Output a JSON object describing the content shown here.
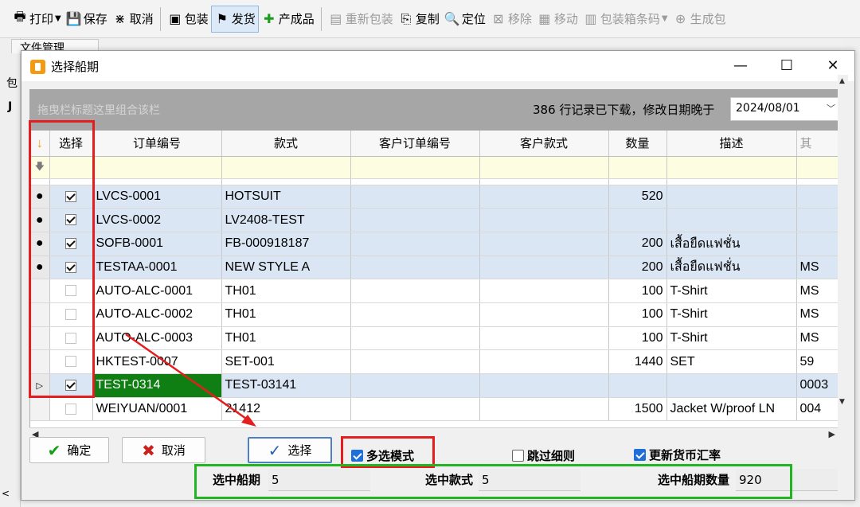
{
  "toolbar": {
    "items": [
      {
        "icon": "printer-icon",
        "label": "打印",
        "caret": true,
        "disabled": false
      },
      {
        "icon": "save-icon",
        "label": "保存",
        "caret": false,
        "disabled": false
      },
      {
        "icon": "cancel-icon",
        "label": "取消",
        "caret": false,
        "disabled": false
      },
      {
        "icon": "pack-icon",
        "label": "包装",
        "caret": false,
        "disabled": false
      },
      {
        "icon": "ship-icon",
        "label": "发货",
        "caret": false,
        "disabled": false,
        "active": true
      },
      {
        "icon": "plus-icon",
        "label": "产成品",
        "caret": false,
        "disabled": false
      },
      {
        "icon": "repack-icon",
        "label": "重新包装",
        "caret": false,
        "disabled": true
      },
      {
        "icon": "copy-icon",
        "label": "复制",
        "caret": false,
        "disabled": false
      },
      {
        "icon": "locate-icon",
        "label": "定位",
        "caret": false,
        "disabled": false
      },
      {
        "icon": "remove-icon",
        "label": "移除",
        "caret": false,
        "disabled": true
      },
      {
        "icon": "move-icon",
        "label": "移动",
        "caret": false,
        "disabled": true
      },
      {
        "icon": "barcode-icon",
        "label": "包装箱条码",
        "caret": true,
        "disabled": true
      },
      {
        "icon": "generate-icon",
        "label": "生成包",
        "caret": false,
        "disabled": true
      }
    ]
  },
  "background": {
    "tab_label": "文件管理",
    "left_label_1": "包",
    "left_label_2": "J",
    "left_label_3": "<"
  },
  "dialog": {
    "title": "选择船期",
    "minimize": "—",
    "maximize": "☐",
    "close": "✕"
  },
  "group_panel": {
    "hint": "拖曳栏标题这里组合该栏",
    "record_text": "386 行记录已下载，修改日期晚于",
    "date_value": "2024/08/01"
  },
  "grid": {
    "columns": [
      "选择",
      "订单编号",
      "款式",
      "客户订单编号",
      "客户款式",
      "数量",
      "描述",
      "其"
    ],
    "rows": [
      {
        "checked": true,
        "selected": true,
        "current": false,
        "order": "LVCS-0001",
        "style": "HOTSUIT",
        "cust_order": "",
        "cust_style": "",
        "qty": "520",
        "desc": "",
        "extra": ""
      },
      {
        "checked": true,
        "selected": true,
        "current": false,
        "order": "LVCS-0002",
        "style": "LV2408-TEST",
        "cust_order": "",
        "cust_style": "",
        "qty": "",
        "desc": "",
        "extra": ""
      },
      {
        "checked": true,
        "selected": true,
        "current": false,
        "order": "SOFB-0001",
        "style": "FB-000918187",
        "cust_order": "",
        "cust_style": "",
        "qty": "200",
        "desc": "เสื้อยืดแฟชั่น",
        "extra": ""
      },
      {
        "checked": true,
        "selected": true,
        "current": false,
        "order": "TESTAA-0001",
        "style": "NEW STYLE A",
        "cust_order": "",
        "cust_style": "",
        "qty": "200",
        "desc": "เสื้อยืดแฟชั่น",
        "extra": "MS"
      },
      {
        "checked": false,
        "selected": false,
        "current": false,
        "order": "AUTO-ALC-0001",
        "style": "TH01",
        "cust_order": "",
        "cust_style": "",
        "qty": "100",
        "desc": "T-Shirt",
        "extra": "MS"
      },
      {
        "checked": false,
        "selected": false,
        "current": false,
        "order": "AUTO-ALC-0002",
        "style": "TH01",
        "cust_order": "",
        "cust_style": "",
        "qty": "100",
        "desc": "T-Shirt",
        "extra": "MS"
      },
      {
        "checked": false,
        "selected": false,
        "current": false,
        "order": "AUTO-ALC-0003",
        "style": "TH01",
        "cust_order": "",
        "cust_style": "",
        "qty": "100",
        "desc": "T-Shirt",
        "extra": "MS"
      },
      {
        "checked": false,
        "selected": false,
        "current": false,
        "order": "HKTEST-0007",
        "style": "SET-001",
        "cust_order": "",
        "cust_style": "",
        "qty": "1440",
        "desc": "SET",
        "extra": "59"
      },
      {
        "checked": true,
        "selected": true,
        "current": true,
        "order": "TEST-0314",
        "style": "TEST-03141",
        "cust_order": "",
        "cust_style": "",
        "qty": "",
        "desc": "",
        "extra": "0003"
      },
      {
        "checked": false,
        "selected": false,
        "current": false,
        "order": "WEIYUAN/0001",
        "style": "21412",
        "cust_order": "",
        "cust_style": "",
        "qty": "1500",
        "desc": "Jacket W/proof LN",
        "extra": "004"
      }
    ]
  },
  "buttons": {
    "ok": "确定",
    "cancel": "取消",
    "select": "选择"
  },
  "options": {
    "multi_select": {
      "label": "多选模式",
      "checked": true
    },
    "skip_details": {
      "label": "跳过细则",
      "checked": false
    },
    "update_rate": {
      "label": "更新货币汇率",
      "checked": true
    }
  },
  "summary": {
    "selected_schedules_label": "选中船期",
    "selected_schedules_value": "5",
    "selected_styles_label": "选中款式",
    "selected_styles_value": "5",
    "selected_qty_label": "选中船期数量",
    "selected_qty_value": "920"
  },
  "colors": {
    "annotation_red": "#e41e1e",
    "annotation_green": "#21b521",
    "current_cell": "#0f7f14",
    "selected_row": "#dbe6f5",
    "checkbox_accent": "#1e6fd9"
  }
}
